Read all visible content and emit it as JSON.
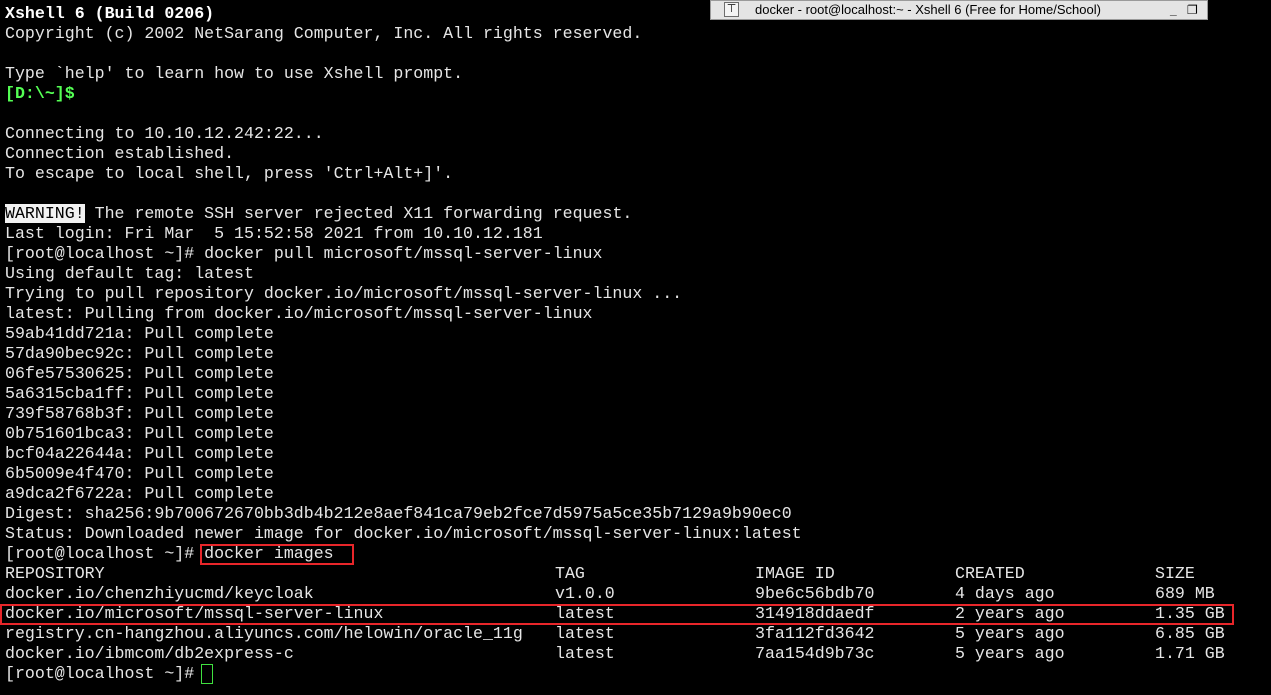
{
  "window": {
    "title": "docker - root@localhost:~ - Xshell 6 (Free for Home/School)",
    "pin_icon": "pin-icon",
    "minimize_label": "_",
    "restore_label": "❐"
  },
  "lines": [
    {
      "text": "Xshell 6 (Build 0206)"
    },
    {
      "text": "Copyright (c) 2002 NetSarang Computer, Inc. All rights reserved."
    },
    {
      "text": ""
    },
    {
      "text": "Type `help' to learn how to use Xshell prompt."
    },
    {
      "text": "[D:\\~]$"
    },
    {
      "text": ""
    },
    {
      "text": "Connecting to 10.10.12.242:22..."
    },
    {
      "text": "Connection established."
    },
    {
      "text": "To escape to local shell, press 'Ctrl+Alt+]'."
    },
    {
      "text": ""
    },
    {
      "warning": "WARNING!",
      "text": " The remote SSH server rejected X11 forwarding request."
    },
    {
      "text": "Last login: Fri Mar  5 15:52:58 2021 from 10.10.12.181"
    },
    {
      "text": "[root@localhost ~]# docker pull microsoft/mssql-server-linux"
    },
    {
      "text": "Using default tag: latest"
    },
    {
      "text": "Trying to pull repository docker.io/microsoft/mssql-server-linux ..."
    },
    {
      "text": "latest: Pulling from docker.io/microsoft/mssql-server-linux"
    },
    {
      "text": "59ab41dd721a: Pull complete"
    },
    {
      "text": "57da90bec92c: Pull complete"
    },
    {
      "text": "06fe57530625: Pull complete"
    },
    {
      "text": "5a6315cba1ff: Pull complete"
    },
    {
      "text": "739f58768b3f: Pull complete"
    },
    {
      "text": "0b751601bca3: Pull complete"
    },
    {
      "text": "bcf04a22644a: Pull complete"
    },
    {
      "text": "6b5009e4f470: Pull complete"
    },
    {
      "text": "a9dca2f6722a: Pull complete"
    },
    {
      "text": "Digest: sha256:9b700672670bb3db4b212e8aef841ca79eb2fce7d5975a5ce35b7129a9b90ec0"
    },
    {
      "text": "Status: Downloaded newer image for docker.io/microsoft/mssql-server-linux:latest"
    },
    {
      "prompt": "[root@localhost ~]# ",
      "text": "docker images"
    }
  ],
  "images_table": {
    "headers": [
      "REPOSITORY",
      "TAG",
      "IMAGE ID",
      "CREATED",
      "SIZE"
    ],
    "rows": [
      [
        "docker.io/chenzhiyucmd/keycloak",
        "v1.0.0",
        "9be6c56bdb70",
        "4 days ago",
        "689 MB"
      ],
      [
        "docker.io/microsoft/mssql-server-linux",
        "latest",
        "314918ddaedf",
        "2 years ago",
        "1.35 GB"
      ],
      [
        "registry.cn-hangzhou.aliyuncs.com/helowin/oracle_11g",
        "latest",
        "3fa112fd3642",
        "5 years ago",
        "6.85 GB"
      ],
      [
        "docker.io/ibmcom/db2express-c",
        "latest",
        "7aa154d9b73c",
        "5 years ago",
        "1.71 GB"
      ]
    ]
  },
  "final_prompt": "[root@localhost ~]# ",
  "colors": {
    "background": "#000000",
    "text": "#e6e6e6",
    "prompt_green": "#54ff54",
    "highlight_red": "#e8262a"
  }
}
